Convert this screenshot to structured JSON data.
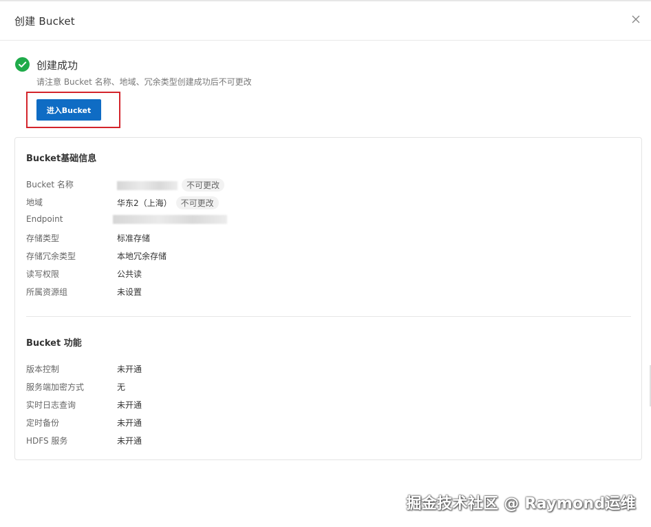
{
  "dialog": {
    "title": "创建 Bucket",
    "close_icon": "close-icon"
  },
  "success": {
    "icon": "check-circle-icon",
    "title": "创建成功",
    "note": "请注意 Bucket 名称、地域、冗余类型创建成功后不可更改",
    "button_label": "进入Bucket",
    "accent_color": "#0f6cc4",
    "success_color": "#1fab4a"
  },
  "basic_info": {
    "title": "Bucket基础信息",
    "rows": [
      {
        "label": "Bucket 名称",
        "value": "",
        "tag": "不可更改"
      },
      {
        "label": "地域",
        "value": "华东2（上海）",
        "tag": "不可更改"
      },
      {
        "label": "Endpoint",
        "value": ""
      },
      {
        "label": "存储类型",
        "value": "标准存储"
      },
      {
        "label": "存储冗余类型",
        "value": "本地冗余存储"
      },
      {
        "label": "读写权限",
        "value": "公共读"
      },
      {
        "label": "所属资源组",
        "value": "未设置"
      }
    ]
  },
  "features": {
    "title": "Bucket 功能",
    "rows": [
      {
        "label": "版本控制",
        "value": "未开通"
      },
      {
        "label": "服务端加密方式",
        "value": "无"
      },
      {
        "label": "实时日志查询",
        "value": "未开通"
      },
      {
        "label": "定时备份",
        "value": "未开通"
      },
      {
        "label": "HDFS 服务",
        "value": "未开通"
      }
    ]
  },
  "watermark": "掘金技术社区 @ Raymond运维"
}
